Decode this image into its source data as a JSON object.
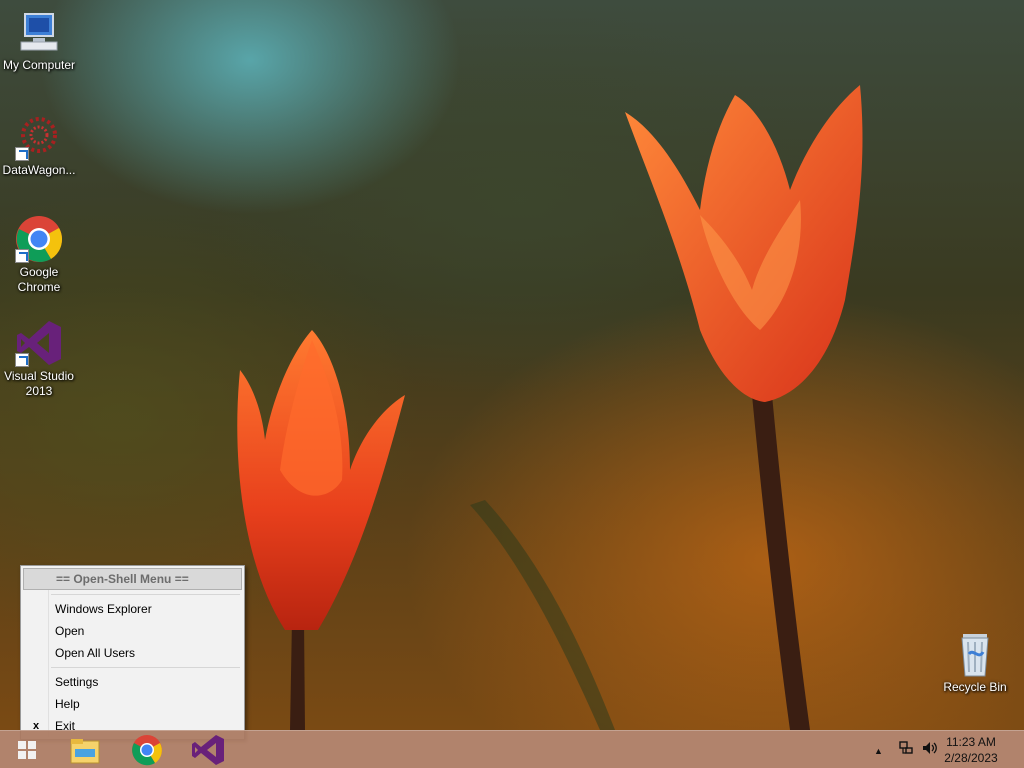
{
  "desktop": {
    "icons": [
      {
        "label": "My Computer",
        "icon": "computer-icon"
      },
      {
        "label": "DataWagon...",
        "icon": "datawagon-icon"
      },
      {
        "label": "Google Chrome",
        "icon": "chrome-icon"
      },
      {
        "label": "Visual Studio 2013",
        "icon": "visual-studio-icon"
      },
      {
        "label": "Recycle Bin",
        "icon": "recycle-bin-icon"
      }
    ]
  },
  "context_menu": {
    "header": "== Open-Shell Menu ==",
    "items": [
      "Windows Explorer",
      "Open",
      "Open All Users",
      "Settings",
      "Help",
      "Exit"
    ],
    "exit_mark": "x"
  },
  "taskbar": {
    "buttons": [
      "start-icon",
      "file-explorer-icon",
      "chrome-icon",
      "visual-studio-icon"
    ],
    "tray_icons": [
      "show-hidden-icons-icon",
      "network-icon",
      "volume-icon"
    ],
    "clock_time": "11:23 AM",
    "clock_date": "2/28/2023"
  },
  "colors": {
    "taskbar": "#aa785f",
    "menu_background": "#f2f2f2",
    "tulip": "#e8401c"
  }
}
